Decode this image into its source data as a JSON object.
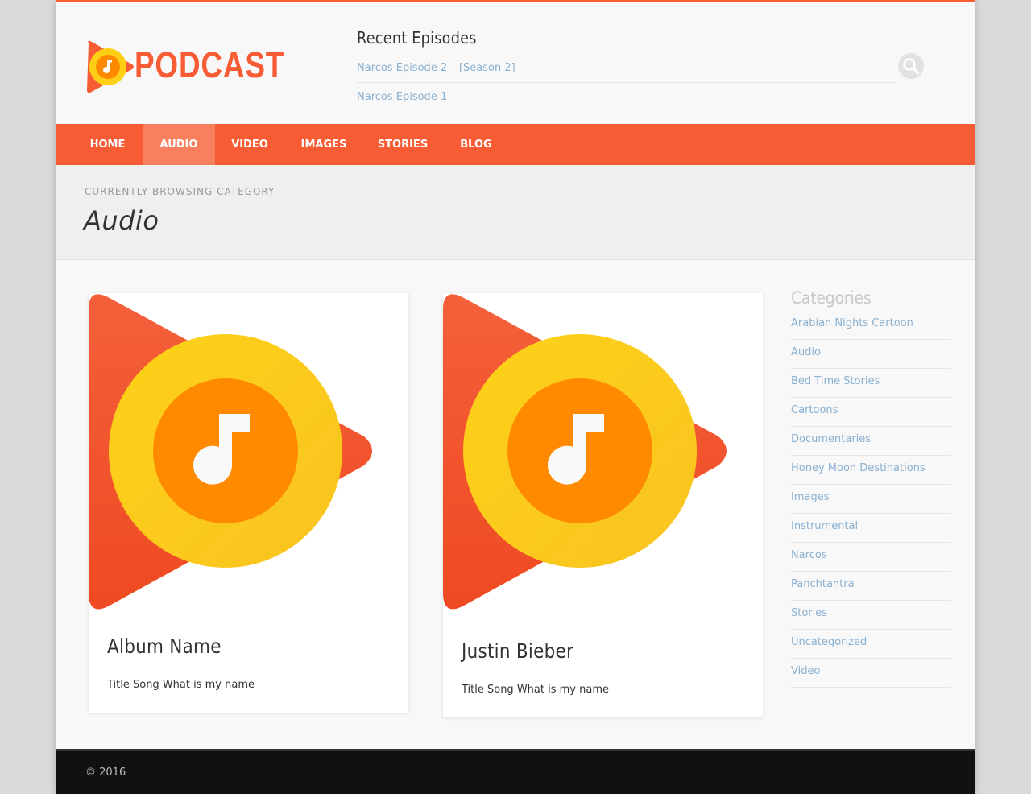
{
  "brand": {
    "logo_text": "PODCAST",
    "accent": "#f75c34",
    "logo_yellow": "#fdd016",
    "logo_orange": "#ff8a00"
  },
  "recent_episodes": {
    "title": "Recent Episodes",
    "items": [
      "Narcos Episode 2 – [Season 2]",
      "Narcos Episode 1"
    ]
  },
  "search": {
    "icon": "search-icon"
  },
  "nav": {
    "items": [
      {
        "label": "HOME",
        "active": false
      },
      {
        "label": "AUDIO",
        "active": true
      },
      {
        "label": "VIDEO",
        "active": false
      },
      {
        "label": "IMAGES",
        "active": false
      },
      {
        "label": "STORIES",
        "active": false
      },
      {
        "label": "BLOG",
        "active": false
      }
    ]
  },
  "category_header": {
    "browsing_label": "CURRENTLY BROWSING CATEGORY",
    "title": "Audio"
  },
  "posts": [
    {
      "title": "Album Name",
      "excerpt": "Title Song What is my name",
      "image": "play-music-icon"
    },
    {
      "title": "Justin Bieber",
      "excerpt": "Title Song What is my name",
      "image": "play-music-icon"
    }
  ],
  "sidebar": {
    "title": "Categories",
    "categories": [
      "Arabian Nights Cartoon",
      "Audio",
      "Bed Time Stories",
      "Cartoons",
      "Documentaries",
      "Honey Moon Destinations",
      "Images",
      "Instrumental",
      "Narcos",
      "Panchtantra",
      "Stories",
      "Uncategorized",
      "Video"
    ]
  },
  "footer": {
    "copyright": "© 2016"
  }
}
